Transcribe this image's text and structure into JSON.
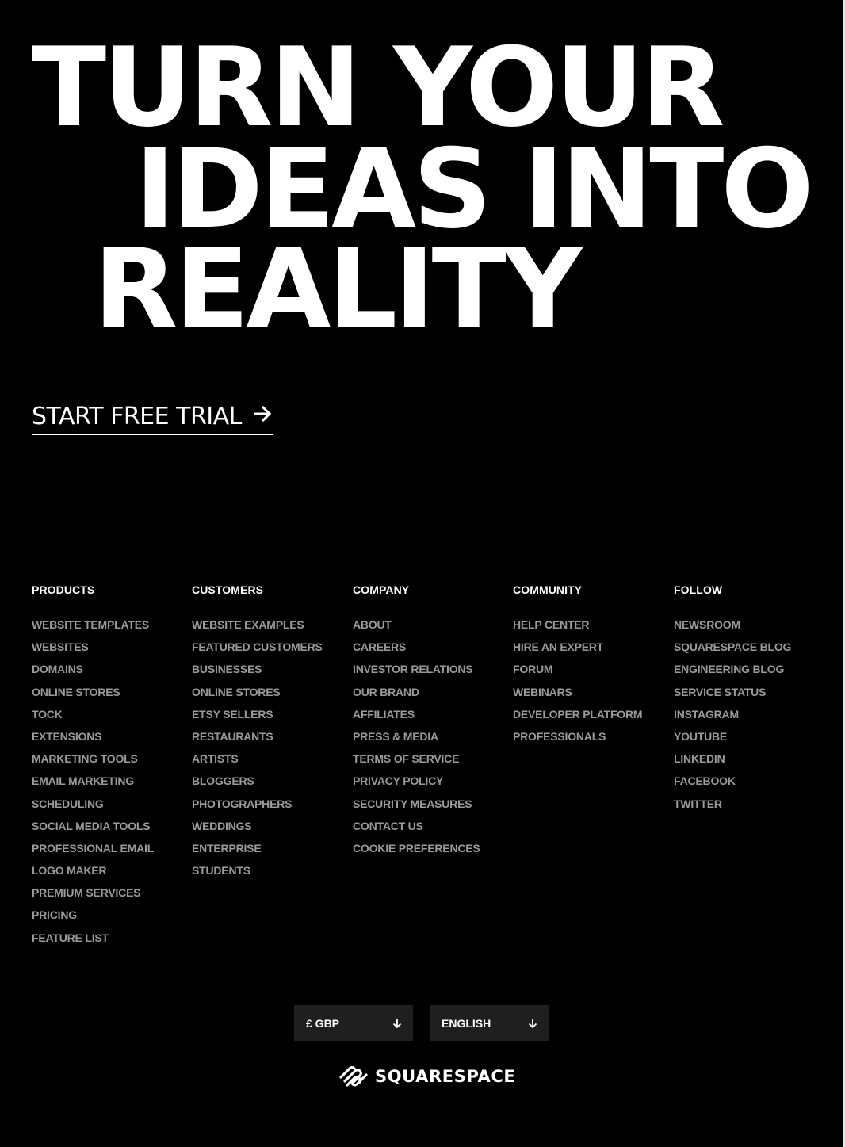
{
  "hero": {
    "line1": "TURN YOUR",
    "line2": "IDEAS INTO",
    "line3": "REALITY"
  },
  "cta": {
    "label": "START FREE TRIAL",
    "icon": "arrow-right-icon"
  },
  "footer": {
    "columns": [
      {
        "title": "PRODUCTS",
        "items": [
          "WEBSITE TEMPLATES",
          "WEBSITES",
          "DOMAINS",
          "ONLINE STORES",
          "TOCK",
          "EXTENSIONS",
          "MARKETING TOOLS",
          "EMAIL MARKETING",
          "SCHEDULING",
          "SOCIAL MEDIA TOOLS",
          "PROFESSIONAL EMAIL",
          "LOGO MAKER",
          "PREMIUM SERVICES",
          "PRICING",
          "FEATURE LIST"
        ]
      },
      {
        "title": "CUSTOMERS",
        "items": [
          "WEBSITE EXAMPLES",
          "FEATURED CUSTOMERS",
          "BUSINESSES",
          "ONLINE STORES",
          "ETSY SELLERS",
          "RESTAURANTS",
          "ARTISTS",
          "BLOGGERS",
          "PHOTOGRAPHERS",
          "WEDDINGS",
          "ENTERPRISE",
          "STUDENTS"
        ]
      },
      {
        "title": "COMPANY",
        "items": [
          "ABOUT",
          "CAREERS",
          "INVESTOR RELATIONS",
          "OUR BRAND",
          "AFFILIATES",
          "PRESS & MEDIA",
          "TERMS OF SERVICE",
          "PRIVACY POLICY",
          "SECURITY MEASURES",
          "CONTACT US",
          "COOKIE PREFERENCES"
        ]
      },
      {
        "title": "COMMUNITY",
        "items": [
          "HELP CENTER",
          "HIRE AN EXPERT",
          "FORUM",
          "WEBINARS",
          "DEVELOPER PLATFORM",
          "PROFESSIONALS"
        ]
      },
      {
        "title": "FOLLOW",
        "items": [
          "NEWSROOM",
          "SQUARESPACE BLOG",
          "ENGINEERING BLOG",
          "SERVICE STATUS",
          "INSTAGRAM",
          "YOUTUBE",
          "LINKEDIN",
          "FACEBOOK",
          "TWITTER"
        ]
      }
    ]
  },
  "selectors": {
    "currency": {
      "value": "£ GBP",
      "icon": "arrow-down-icon"
    },
    "language": {
      "value": "ENGLISH",
      "icon": "arrow-down-icon"
    }
  },
  "brand": {
    "name": "SQUARESPACE",
    "icon": "squarespace-logo-icon"
  },
  "colors": {
    "background": "#000000",
    "text": "#ffffff",
    "link_muted": "#9a9a9a",
    "select_bg": "#1f1f1f"
  }
}
